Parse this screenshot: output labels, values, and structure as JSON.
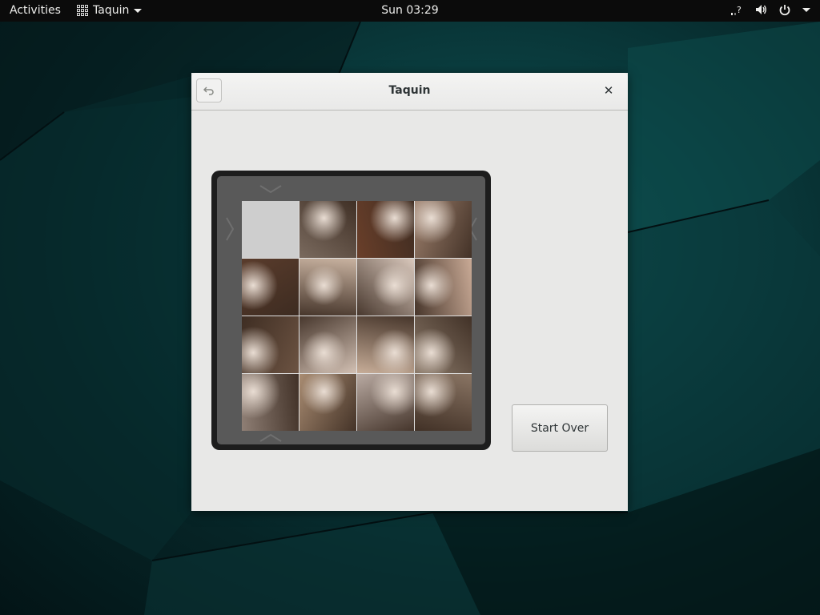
{
  "topbar": {
    "activities": "Activities",
    "app_name": "Taquin",
    "clock": "Sun 03:29",
    "icons": [
      "network-unknown-icon",
      "volume-icon",
      "power-icon",
      "chevron-down-icon"
    ]
  },
  "window": {
    "title": "Taquin",
    "back_icon": "undo-icon",
    "close_glyph": "✕"
  },
  "game": {
    "grid_size": 4,
    "empty_tile": 0,
    "tile_colors": [
      [
        "#cecece",
        "#7a6a5e",
        "#6a3f2a",
        "#9c7f6c"
      ],
      [
        "#5a3c2c",
        "#c8b2a0",
        "#d9c8bc",
        "#c9aa96"
      ],
      [
        "#6c5342",
        "#d2c0b3",
        "#c7ad98",
        "#8b7a6a"
      ],
      [
        "#8f7f75",
        "#a98c72",
        "#b9aaa2",
        "#8a7564"
      ]
    ],
    "start_over_label": "Start Over"
  },
  "colors": {
    "desktop": "#0a3c3e",
    "topbar": "#0b0b0b",
    "board_frame": "#1d1d1d",
    "board_inner": "#595959"
  }
}
